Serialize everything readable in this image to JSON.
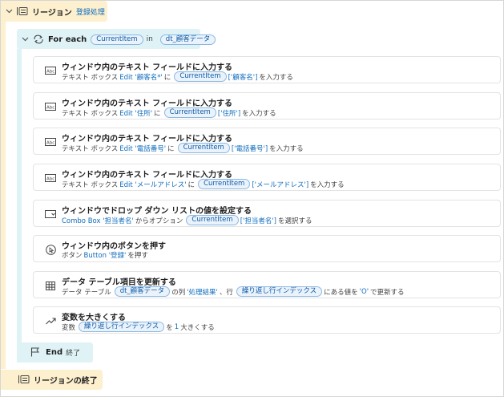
{
  "region": {
    "keyword": "リージョン",
    "name": "登録処理",
    "end_label": "リージョンの終了"
  },
  "loop": {
    "keyword": "For each",
    "item_var": "CurrentItem",
    "in_word": "in",
    "collection_var": "dt_顧客データ",
    "end_keyword": "End",
    "end_suffix": "終了"
  },
  "actions": [
    {
      "icon": "text-field-icon",
      "title": "ウィンドウ内のテキスト フィールドに入力する",
      "desc": {
        "prefix": "テキスト ボックス",
        "link": "Edit '顧客名*'",
        "mid": "に",
        "pill": "CurrentItem",
        "pill_suffix": "['顧客名']",
        "suffix": "を入力する"
      }
    },
    {
      "icon": "text-field-icon",
      "title": "ウィンドウ内のテキスト フィールドに入力する",
      "desc": {
        "prefix": "テキスト ボックス",
        "link": "Edit '住所'",
        "mid": "に",
        "pill": "CurrentItem",
        "pill_suffix": "['住所']",
        "suffix": "を入力する"
      }
    },
    {
      "icon": "text-field-icon",
      "title": "ウィンドウ内のテキスト フィールドに入力する",
      "desc": {
        "prefix": "テキスト ボックス",
        "link": "Edit '電話番号'",
        "mid": "に",
        "pill": "CurrentItem",
        "pill_suffix": "['電話番号']",
        "suffix": "を入力する"
      }
    },
    {
      "icon": "text-field-icon",
      "title": "ウィンドウ内のテキスト フィールドに入力する",
      "desc": {
        "prefix": "テキスト ボックス",
        "link": "Edit 'メールアドレス'",
        "mid": "に",
        "pill": "CurrentItem",
        "pill_suffix": "['メールアドレス']",
        "suffix": "を入力する"
      }
    },
    {
      "icon": "dropdown-icon",
      "title": "ウィンドウでドロップ ダウン リストの値を設定する",
      "desc": {
        "prefix": "",
        "link": "Combo Box '担当者名'",
        "mid": "からオプション",
        "pill": "CurrentItem",
        "pill_suffix": "['担当者名']",
        "suffix": "を選択する"
      }
    },
    {
      "icon": "button-press-icon",
      "title": "ウィンドウ内のボタンを押す",
      "desc": {
        "prefix": "ボタン",
        "link": "Button '登録'",
        "mid": "を押す",
        "pill": "",
        "pill_suffix": "",
        "suffix": ""
      }
    },
    {
      "icon": "table-icon",
      "title": "データ テーブル項目を更新する",
      "desc": {
        "prefix": "データ テーブル",
        "link": "",
        "mid": "",
        "pill": "dt_顧客データ",
        "pill_suffix": "",
        "suffix": "の列",
        "link2": "'処理結果'",
        "mid2": "、行",
        "pill2": "繰り返し行インデックス",
        "mid3": "にある値を",
        "link3": "'O'",
        "suffix2": "で更新する"
      }
    },
    {
      "icon": "trend-up-icon",
      "title": "変数を大きくする",
      "desc": {
        "prefix": "変数",
        "link": "",
        "mid": "",
        "pill": "繰り返し行インデックス",
        "pill_suffix": "",
        "suffix": "を",
        "link2": "1",
        "mid2": "大きくする"
      }
    }
  ]
}
